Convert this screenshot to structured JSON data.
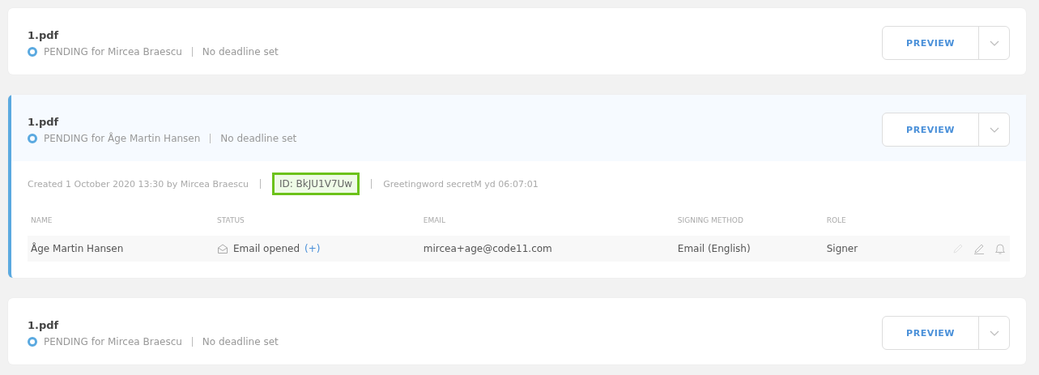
{
  "documents": [
    {
      "name": "1.pdf",
      "status": "PENDING for Mircea Braescu",
      "deadline": "No deadline set",
      "button": "PREVIEW",
      "expanded": false
    },
    {
      "name": "1.pdf",
      "status": "PENDING for Åge Martin Hansen",
      "deadline": "No deadline set",
      "button": "PREVIEW",
      "expanded": true,
      "details": {
        "created": "Created 1 October 2020 13:30 by Mircea Braescu",
        "id": "ID: BkJU1V7Uw",
        "extra": "Greetingword secretM yd 06:07:01",
        "columns": [
          "NAME",
          "STATUS",
          "EMAIL",
          "SIGNING METHOD",
          "ROLE"
        ],
        "rows": [
          {
            "name": "Åge Martin Hansen",
            "status": "Email opened",
            "status_link": "(+)",
            "email": "mircea+age@code11.com",
            "method": "Email (English)",
            "role": "Signer"
          }
        ]
      }
    },
    {
      "name": "1.pdf",
      "status": "PENDING for Mircea Braescu",
      "deadline": "No deadline set",
      "button": "PREVIEW",
      "expanded": false
    }
  ]
}
